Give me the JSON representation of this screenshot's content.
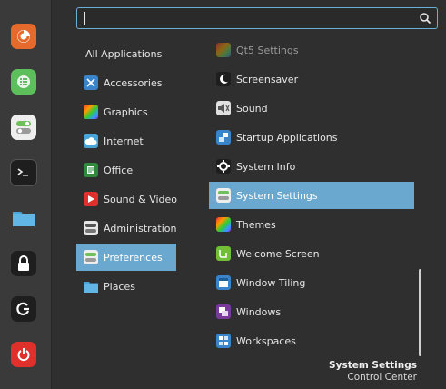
{
  "search": {
    "placeholder": "",
    "value": ""
  },
  "favorites": [
    {
      "name": "firefox",
      "color": "#e66a2c"
    },
    {
      "name": "grid",
      "color": "#5cbf5c"
    },
    {
      "name": "toggles",
      "color": "#5aa6d6"
    },
    {
      "name": "terminal",
      "color": "#222222"
    },
    {
      "name": "files",
      "color": "#4aa3d9"
    },
    {
      "name": "lock",
      "color": "#222222"
    },
    {
      "name": "logout",
      "color": "#222222"
    },
    {
      "name": "power",
      "color": "#e0302b"
    }
  ],
  "categories": [
    {
      "label": "All Applications"
    },
    {
      "label": "Accessories"
    },
    {
      "label": "Graphics"
    },
    {
      "label": "Internet"
    },
    {
      "label": "Office"
    },
    {
      "label": "Sound & Video"
    },
    {
      "label": "Administration"
    },
    {
      "label": "Preferences"
    },
    {
      "label": "Places"
    }
  ],
  "apps": [
    {
      "label": "Qt5 Settings"
    },
    {
      "label": "Screensaver"
    },
    {
      "label": "Sound"
    },
    {
      "label": "Startup Applications"
    },
    {
      "label": "System Info"
    },
    {
      "label": "System Settings"
    },
    {
      "label": "Themes"
    },
    {
      "label": "Welcome Screen"
    },
    {
      "label": "Window Tiling"
    },
    {
      "label": "Windows"
    },
    {
      "label": "Workspaces"
    }
  ],
  "selected": {
    "category": "Preferences",
    "app": "System Settings"
  },
  "description": {
    "title": "System Settings",
    "subtitle": "Control Center"
  },
  "colors": {
    "accent": "#6aa8cf",
    "background": "#2f2f2f",
    "rail": "#3a3a3a"
  }
}
